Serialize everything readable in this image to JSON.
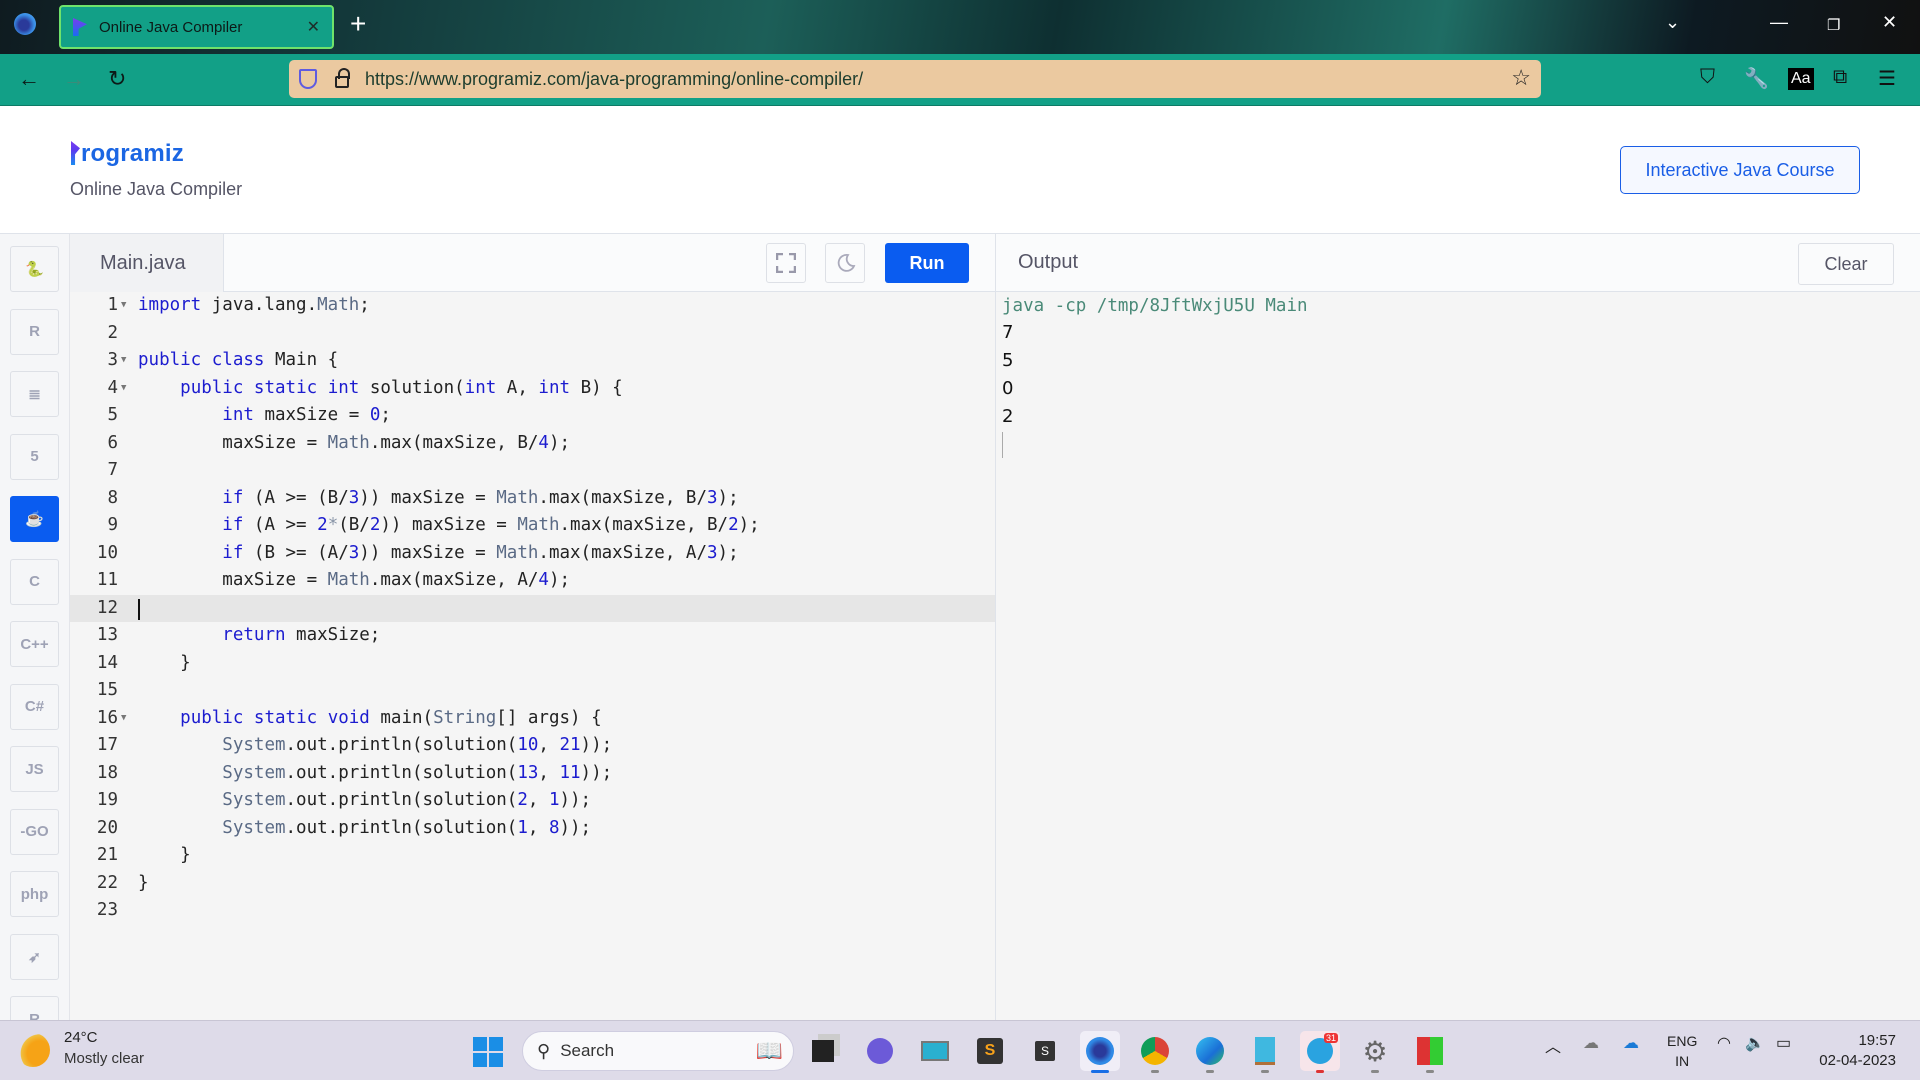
{
  "browser": {
    "tab_title": "Online Java Compiler",
    "url": "https://www.programiz.com/java-programming/online-compiler/",
    "reader_label": "Aa"
  },
  "header": {
    "logo_text": "rogramiz",
    "subtitle": "Online Java Compiler",
    "course_button": "Interactive Java Course"
  },
  "sidebar": {
    "languages": [
      {
        "name": "python",
        "glyph": "🐍",
        "active": false
      },
      {
        "name": "r",
        "glyph": "R",
        "active": false
      },
      {
        "name": "sql",
        "glyph": "≣",
        "active": false
      },
      {
        "name": "html",
        "glyph": "5",
        "active": false
      },
      {
        "name": "java",
        "glyph": "☕",
        "active": true
      },
      {
        "name": "c",
        "glyph": "C",
        "active": false
      },
      {
        "name": "cpp",
        "glyph": "C++",
        "active": false
      },
      {
        "name": "csharp",
        "glyph": "C#",
        "active": false
      },
      {
        "name": "javascript",
        "glyph": "JS",
        "active": false
      },
      {
        "name": "go",
        "glyph": "-GO",
        "active": false
      },
      {
        "name": "php",
        "glyph": "php",
        "active": false
      },
      {
        "name": "swift",
        "glyph": "➶",
        "active": false
      },
      {
        "name": "rust",
        "glyph": "R",
        "active": false
      }
    ]
  },
  "editor": {
    "filename": "Main.java",
    "run_label": "Run",
    "current_line": 12,
    "lines": [
      "import java.lang.Math;",
      "",
      "public class Main {",
      "    public static int solution(int A, int B) {",
      "        int maxSize = 0;",
      "        maxSize = Math.max(maxSize, B/4);",
      "",
      "        if (A >= (B/3)) maxSize = Math.max(maxSize, B/3);",
      "        if (A >= 2*(B/2)) maxSize = Math.max(maxSize, B/2);",
      "        if (B >= (A/3)) maxSize = Math.max(maxSize, A/3);",
      "        maxSize = Math.max(maxSize, A/4);",
      "",
      "        return maxSize;",
      "    }",
      "",
      "    public static void main(String[] args) {",
      "        System.out.println(solution(10, 21));",
      "        System.out.println(solution(13, 11));",
      "        System.out.println(solution(2, 1));",
      "        System.out.println(solution(1, 8));",
      "    }",
      "}",
      ""
    ],
    "foldable_lines": [
      1,
      3,
      4,
      16
    ]
  },
  "output": {
    "title": "Output",
    "clear_label": "Clear",
    "command": "java -cp /tmp/8JftWxjU5U Main",
    "lines": [
      "7",
      "5",
      "0",
      "2"
    ]
  },
  "taskbar": {
    "weather_temp": "24°C",
    "weather_desc": "Mostly clear",
    "search_placeholder": "Search",
    "telegram_badge": "31",
    "lang_top": "ENG",
    "lang_bottom": "IN",
    "time": "19:57",
    "date": "02-04-2023"
  }
}
